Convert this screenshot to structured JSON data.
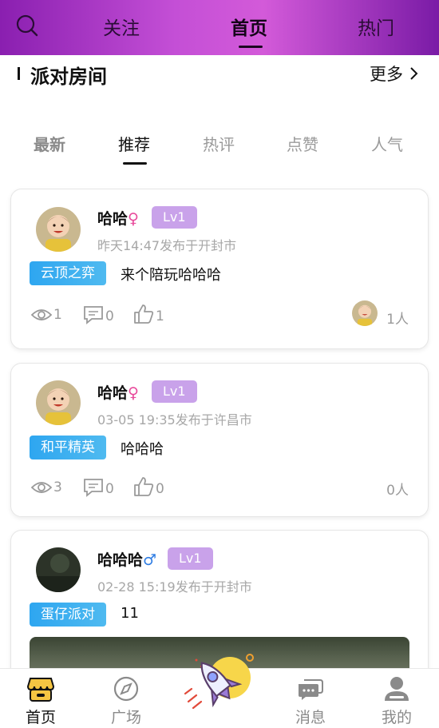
{
  "header": {
    "tabs": [
      {
        "label": "关注",
        "active": false
      },
      {
        "label": "首页",
        "active": true
      },
      {
        "label": "热门",
        "active": false
      }
    ]
  },
  "section": {
    "title": "派对房间",
    "more_label": "更多"
  },
  "filters": [
    {
      "label": "最新"
    },
    {
      "label": "推荐"
    },
    {
      "label": "热评"
    },
    {
      "label": "点赞"
    },
    {
      "label": "人气"
    }
  ],
  "posts": [
    {
      "name": "哈哈",
      "gender": "♀",
      "level": "Lv1",
      "meta": "昨天14:47发布于开封市",
      "game": "云顶之弈",
      "content": "来个陪玩哈哈哈",
      "views": "1",
      "comments": "0",
      "likes": "1",
      "joined": "1人"
    },
    {
      "name": "哈哈",
      "gender": "♀",
      "level": "Lv1",
      "meta": "03-05 19:35发布于许昌市",
      "game": "和平精英",
      "content": "哈哈哈",
      "views": "3",
      "comments": "0",
      "likes": "0",
      "joined": "0人"
    },
    {
      "name": "哈哈哈",
      "gender": "♂",
      "level": "Lv1",
      "meta": "02-28 15:19发布于开封市",
      "game": "蛋仔派对",
      "content": "11"
    }
  ],
  "bottom_nav": [
    {
      "label": "首页",
      "icon": "home-shop-icon",
      "active": true
    },
    {
      "label": "广场",
      "icon": "compass-icon",
      "active": false
    },
    {
      "label": "消息",
      "icon": "chat-bubble-icon",
      "active": false
    },
    {
      "label": "我的",
      "icon": "user-icon",
      "active": false
    }
  ],
  "colors": {
    "header_gradient_start": "#8a1fb0",
    "header_gradient_mid": "#d35ad9",
    "level_badge": "#c9a2ea",
    "game_tag": "#2ea6f0",
    "female": "#e84a9b",
    "male": "#2f7de3"
  }
}
